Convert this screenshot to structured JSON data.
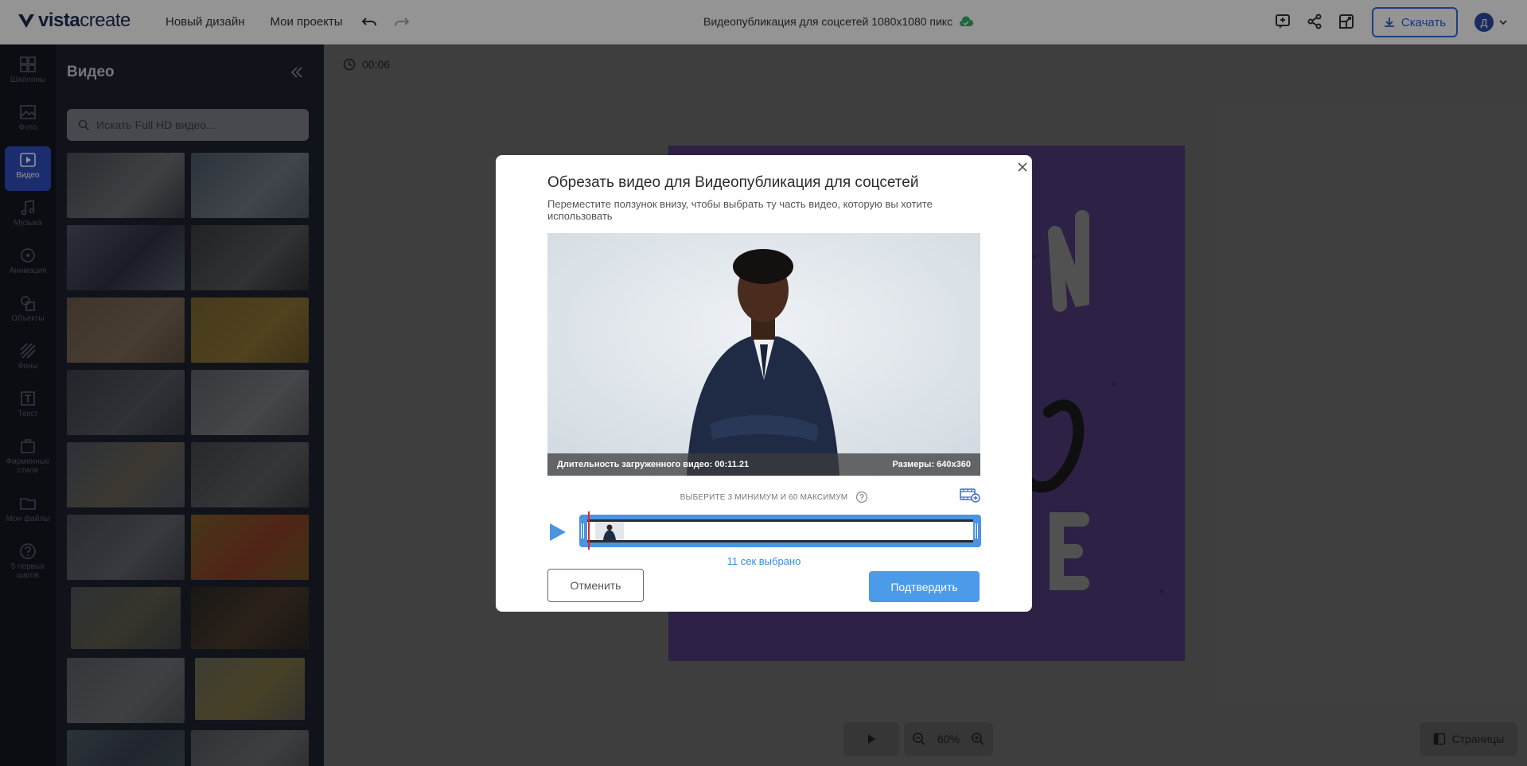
{
  "header": {
    "logo_text_bold": "vista",
    "logo_text_light": "create",
    "nav": [
      "Новый дизайн",
      "Мои проекты"
    ],
    "document_title": "Видеопубликация для соцсетей 1080x1080  пикс",
    "download_label": "Скачать",
    "avatar_initial": "Д"
  },
  "rail": {
    "items": [
      {
        "label": "Шаблоны",
        "icon": "templates-icon"
      },
      {
        "label": "Фото",
        "icon": "photo-icon"
      },
      {
        "label": "Видео",
        "icon": "video-icon",
        "active": true
      },
      {
        "label": "Музыка",
        "icon": "music-icon"
      },
      {
        "label": "Анимация",
        "icon": "animation-icon"
      },
      {
        "label": "Объекты",
        "icon": "objects-icon"
      },
      {
        "label": "Фоны",
        "icon": "backgrounds-icon"
      },
      {
        "label": "Текст",
        "icon": "text-icon"
      },
      {
        "label": "Фирменные стили",
        "icon": "brand-icon"
      },
      {
        "label": "Мои файлы",
        "icon": "folder-icon"
      },
      {
        "label": "5 первых шагов",
        "icon": "help-icon"
      }
    ]
  },
  "panel": {
    "title": "Видео",
    "search_placeholder": "Искать Full HD видео..."
  },
  "workspace": {
    "duration": "00:06",
    "zoom": "60%",
    "pages_label": "Страницы"
  },
  "modal": {
    "title": "Обрезать видео для Видеопубликация для соцсетей",
    "subtitle": "Переместите ползунок внизу, чтобы выбрать ту часть видео, которую вы хотите использовать",
    "duration_label": "Длительность загруженного видео: 00:11.21",
    "size_label": "Размеры: 640x360",
    "hint": "ВЫБЕРИТЕ 3 МИНИМУМ И 60 МАКСИМУМ",
    "selected": "11 сек выбрано",
    "cancel": "Отменить",
    "confirm": "Подтвердить"
  },
  "colors": {
    "accent": "#2f4fbf",
    "timeline": "#4b94e0",
    "confirm": "#4b9be8",
    "playhead": "#e02424"
  }
}
